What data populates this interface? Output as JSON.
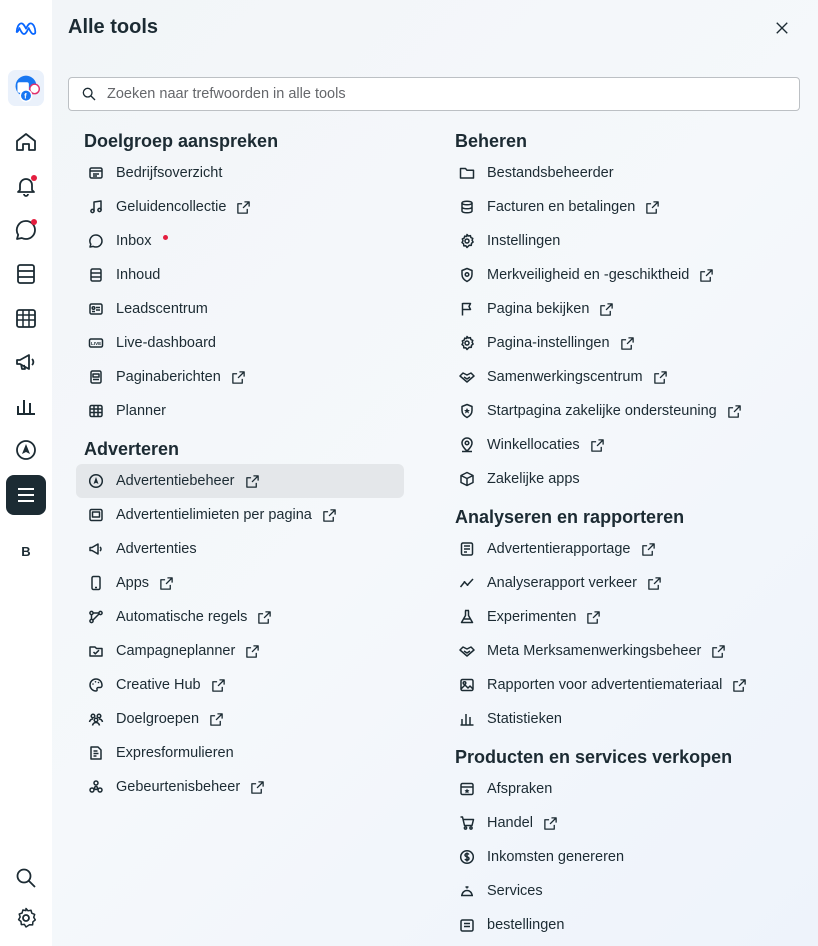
{
  "rail": {
    "items": [
      {
        "name": "meta-logo-icon"
      },
      {
        "name": "account-avatar-icon"
      },
      {
        "name": "home-icon"
      },
      {
        "name": "notifications-icon"
      },
      {
        "name": "inbox-icon"
      },
      {
        "name": "content-icon"
      },
      {
        "name": "planner-icon"
      },
      {
        "name": "ads-icon"
      },
      {
        "name": "insights-icon"
      },
      {
        "name": "ads-manager-icon"
      },
      {
        "name": "all-tools-icon"
      }
    ],
    "letter": "B"
  },
  "panel": {
    "title": "Alle tools",
    "search": {
      "placeholder": "Zoeken naar trefwoorden in alle tools",
      "value": ""
    }
  },
  "sections": {
    "doelgroep": {
      "title": "Doelgroep aanspreken",
      "items": [
        {
          "label": "Bedrijfsoverzicht",
          "icon": "overview-icon",
          "external": false
        },
        {
          "label": "Geluidencollectie",
          "icon": "music-note-icon",
          "external": true
        },
        {
          "label": "Inbox",
          "icon": "chat-bubble-icon",
          "external": false,
          "badge": true
        },
        {
          "label": "Inhoud",
          "icon": "content-icon",
          "external": false
        },
        {
          "label": "Leadscentrum",
          "icon": "lead-card-icon",
          "external": false
        },
        {
          "label": "Live-dashboard",
          "icon": "live-icon",
          "external": false
        },
        {
          "label": "Paginaberichten",
          "icon": "page-posts-icon",
          "external": true
        },
        {
          "label": "Planner",
          "icon": "calendar-grid-icon",
          "external": false
        }
      ]
    },
    "adverteren": {
      "title": "Adverteren",
      "items": [
        {
          "label": "Advertentiebeheer",
          "icon": "navigation-icon",
          "external": true
        },
        {
          "label": "Advertentielimieten per pagina",
          "icon": "ad-limit-icon",
          "external": true
        },
        {
          "label": "Advertenties",
          "icon": "megaphone-icon",
          "external": false
        },
        {
          "label": "Apps",
          "icon": "mobile-icon",
          "external": true
        },
        {
          "label": "Automatische regels",
          "icon": "rules-icon",
          "external": true
        },
        {
          "label": "Campagneplanner",
          "icon": "campaign-check-icon",
          "external": true
        },
        {
          "label": "Creative Hub",
          "icon": "palette-icon",
          "external": true
        },
        {
          "label": "Doelgroepen",
          "icon": "people-icon",
          "external": true
        },
        {
          "label": "Expresformulieren",
          "icon": "form-icon",
          "external": false
        },
        {
          "label": "Gebeurtenisbeheer",
          "icon": "events-icon",
          "external": true
        }
      ]
    },
    "beheren": {
      "title": "Beheren",
      "items": [
        {
          "label": "Bestandsbeheerder",
          "icon": "folder-icon",
          "external": false
        },
        {
          "label": "Facturen en betalingen",
          "icon": "billing-icon",
          "external": true
        },
        {
          "label": "Instellingen",
          "icon": "gear-icon",
          "external": false
        },
        {
          "label": "Merkveiligheid en -geschiktheid",
          "icon": "shield-icon",
          "external": true
        },
        {
          "label": "Pagina bekijken",
          "icon": "flag-icon",
          "external": true
        },
        {
          "label": "Pagina-instellingen",
          "icon": "gear-icon",
          "external": true
        },
        {
          "label": "Samenwerkingscentrum",
          "icon": "handshake-icon",
          "external": true
        },
        {
          "label": "Startpagina zakelijke ondersteuning",
          "icon": "support-shield-icon",
          "external": true
        },
        {
          "label": "Winkellocaties",
          "icon": "location-pin-icon",
          "external": true
        },
        {
          "label": "Zakelijke apps",
          "icon": "cube-icon",
          "external": false
        }
      ]
    },
    "analyseren": {
      "title": "Analyseren en rapporteren",
      "items": [
        {
          "label": "Advertentierapportage",
          "icon": "report-icon",
          "external": true
        },
        {
          "label": "Analyserapport verkeer",
          "icon": "trend-icon",
          "external": true
        },
        {
          "label": "Experimenten",
          "icon": "flask-icon",
          "external": true
        },
        {
          "label": "Meta Merksamenwerkingsbeheer",
          "icon": "handshake-icon",
          "external": true
        },
        {
          "label": "Rapporten voor advertentiemateriaal",
          "icon": "image-icon",
          "external": true
        },
        {
          "label": "Statistieken",
          "icon": "bar-chart-icon",
          "external": false
        }
      ]
    },
    "verkopen": {
      "title": "Producten en services verkopen",
      "items": [
        {
          "label": "Afspraken",
          "icon": "appointment-icon",
          "external": false
        },
        {
          "label": "Handel",
          "icon": "cart-icon",
          "external": true
        },
        {
          "label": "Inkomsten genereren",
          "icon": "dollar-icon",
          "external": false
        },
        {
          "label": "Services",
          "icon": "service-bell-icon",
          "external": false
        },
        {
          "label": "bestellingen",
          "icon": "orders-icon",
          "external": false
        }
      ]
    }
  }
}
